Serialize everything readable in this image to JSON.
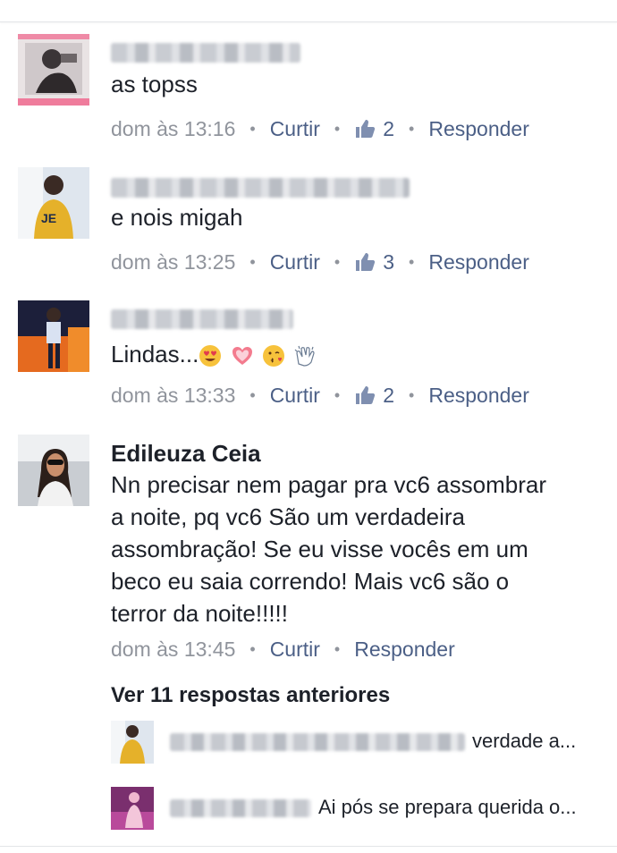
{
  "comments": [
    {
      "author": "",
      "text": "as topss",
      "time": "dom às 13:16",
      "like_label": "Curtir",
      "likes": "2",
      "reply_label": "Responder"
    },
    {
      "author": "",
      "text": "e nois migah",
      "time": "dom às 13:25",
      "like_label": "Curtir",
      "likes": "3",
      "reply_label": "Responder"
    },
    {
      "author": "",
      "text": "Lindas...",
      "emojis": [
        "heart-eyes-emoji",
        "sparkling-heart-emoji",
        "kissing-face-emoji",
        "clapping-hands-emoji"
      ],
      "time": "dom às 13:33",
      "like_label": "Curtir",
      "likes": "2",
      "reply_label": "Responder"
    },
    {
      "author": "Edileuza Ceia",
      "text_lines": [
        "Nn precisar nem pagar pra vc6 assombrar",
        "a noite, pq vc6 São  um verdadeira",
        "assombração!  Se eu visse vocês  em um",
        "beco eu saia correndo! Mais  vc6 são  o",
        "terror da noite!!!!!"
      ],
      "time": "dom às 13:45",
      "like_label": "Curtir",
      "reply_label": "Responder"
    }
  ],
  "view_replies": "Ver 11 respostas anteriores",
  "replies": [
    {
      "text": "verdade a..."
    },
    {
      "text": "Ai pós se prepara querida o..."
    }
  ],
  "colors": {
    "text": "#1d2129",
    "meta": "#90949c",
    "link": "#4b5f86",
    "divider": "#e3e5e8"
  }
}
